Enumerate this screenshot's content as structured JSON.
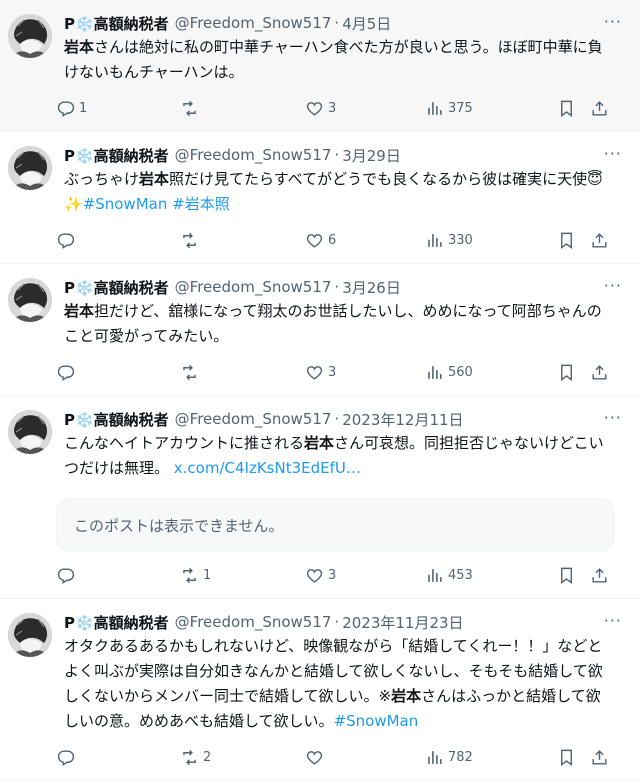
{
  "colors": {
    "link": "#1d9bf0",
    "muted": "#536471",
    "text": "#0f1419"
  },
  "icons": {
    "more": "more-icon",
    "reply": "reply-icon",
    "retweet": "retweet-icon",
    "like": "heart-icon",
    "views": "views-icon",
    "bookmark": "bookmark-icon",
    "share": "share-icon"
  },
  "tweets": [
    {
      "name": "P❄️高額納税者",
      "handle": "@Freedom_Snow517",
      "date": "4月5日",
      "segments": [
        {
          "t": "岩本",
          "b": true
        },
        {
          "t": "さんは絶対に私の町中華チャーハン食べた方が良いと思う。ほぼ町中華に負けないもんチャーハンは。"
        }
      ],
      "replies": "1",
      "retweets": "",
      "likes": "3",
      "views": "375"
    },
    {
      "name": "P❄️高額納税者",
      "handle": "@Freedom_Snow517",
      "date": "3月29日",
      "segments": [
        {
          "t": "ぶっちゃけ"
        },
        {
          "t": "岩本",
          "b": true
        },
        {
          "t": "照だけ見てたらすべてがどうでも良くなるから彼は確実に天使😇✨"
        },
        {
          "t": "#SnowMan",
          "tag": true
        },
        {
          "t": " "
        },
        {
          "t": "#岩本照",
          "tag": true
        }
      ],
      "replies": "",
      "retweets": "",
      "likes": "6",
      "views": "330"
    },
    {
      "name": "P❄️高額納税者",
      "handle": "@Freedom_Snow517",
      "date": "3月26日",
      "segments": [
        {
          "t": "岩本",
          "b": true
        },
        {
          "t": "担だけど、舘様になって翔太のお世話したいし、めめになって阿部ちゃんのこと可愛がってみたい。"
        }
      ],
      "replies": "",
      "retweets": "",
      "likes": "3",
      "views": "560"
    },
    {
      "name": "P❄️高額納税者",
      "handle": "@Freedom_Snow517",
      "date": "2023年12月11日",
      "segments": [
        {
          "t": "こんなヘイトアカウントに推される"
        },
        {
          "t": "岩本",
          "b": true
        },
        {
          "t": "さん可哀想。同担拒否じゃないけどこいつだけは無理。 "
        },
        {
          "t": "x.com/C4IzKsNt3EdEfU…",
          "tag": true
        }
      ],
      "unavailable": "このポストは表示できません。",
      "replies": "",
      "retweets": "1",
      "likes": "3",
      "views": "453"
    },
    {
      "name": "P❄️高額納税者",
      "handle": "@Freedom_Snow517",
      "date": "2023年11月23日",
      "segments": [
        {
          "t": "オタクあるあるかもしれないけど、映像観ながら「結婚してくれー！！」などとよく叫ぶが実際は自分如きなんかと結婚して欲しくないし、そもそも結婚して欲しくないからメンバー同士で結婚して欲しい。※"
        },
        {
          "t": "岩本",
          "b": true
        },
        {
          "t": "さんはふっかと結婚して欲しいの意。めめあべも結婚して欲しい。"
        },
        {
          "t": "#SnowMan",
          "tag": true
        }
      ],
      "replies": "",
      "retweets": "2",
      "likes": "",
      "views": "782"
    }
  ]
}
